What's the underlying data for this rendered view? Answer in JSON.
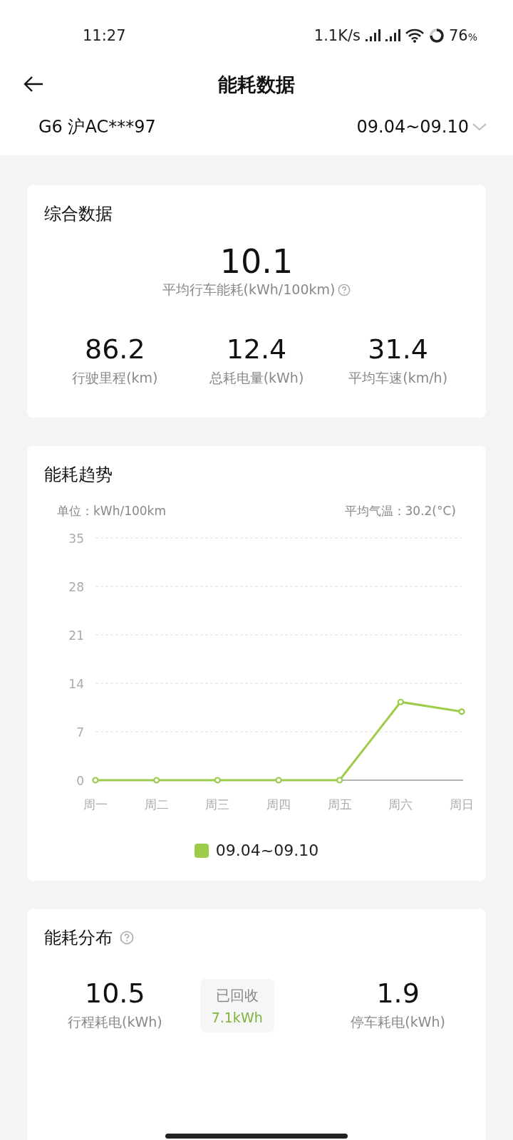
{
  "status_bar": {
    "time": "11:27",
    "speed": "1.1K/s",
    "battery": "76",
    "battery_unit": "%"
  },
  "header": {
    "title": "能耗数据"
  },
  "vehicle": {
    "name": "G6 沪AC***97",
    "period": "09.04~09.10"
  },
  "summary": {
    "title": "综合数据",
    "main_value": "10.1",
    "main_label": "平均行车能耗(kWh/100km)",
    "stats": [
      {
        "value": "86.2",
        "label": "行驶里程(km)"
      },
      {
        "value": "12.4",
        "label": "总耗电量(kWh)"
      },
      {
        "value": "31.4",
        "label": "平均车速(km/h)"
      }
    ]
  },
  "trend": {
    "title": "能耗趋势",
    "unit": "单位：kWh/100km",
    "temperature": "平均气温：30.2(°C)",
    "chart_data": {
      "type": "line",
      "categories": [
        "周一",
        "周二",
        "周三",
        "周四",
        "周五",
        "周六",
        "周日"
      ],
      "series": [
        {
          "name": "09.04~09.10",
          "color": "#9ccc4a",
          "values": [
            0,
            0,
            0,
            0,
            0,
            11.3,
            9.9
          ]
        }
      ],
      "ylim": [
        0,
        35
      ],
      "yticks": [
        0,
        7,
        14,
        21,
        28,
        35
      ],
      "grid": true,
      "marker": "circle"
    }
  },
  "distribution": {
    "title": "能耗分布",
    "trip_value": "10.5",
    "trip_label": "行程耗电(kWh)",
    "recovered_label": "已回收",
    "recovered_value": "7.1kWh",
    "parking_value": "1.9",
    "parking_label": "停车耗电(kWh)"
  }
}
